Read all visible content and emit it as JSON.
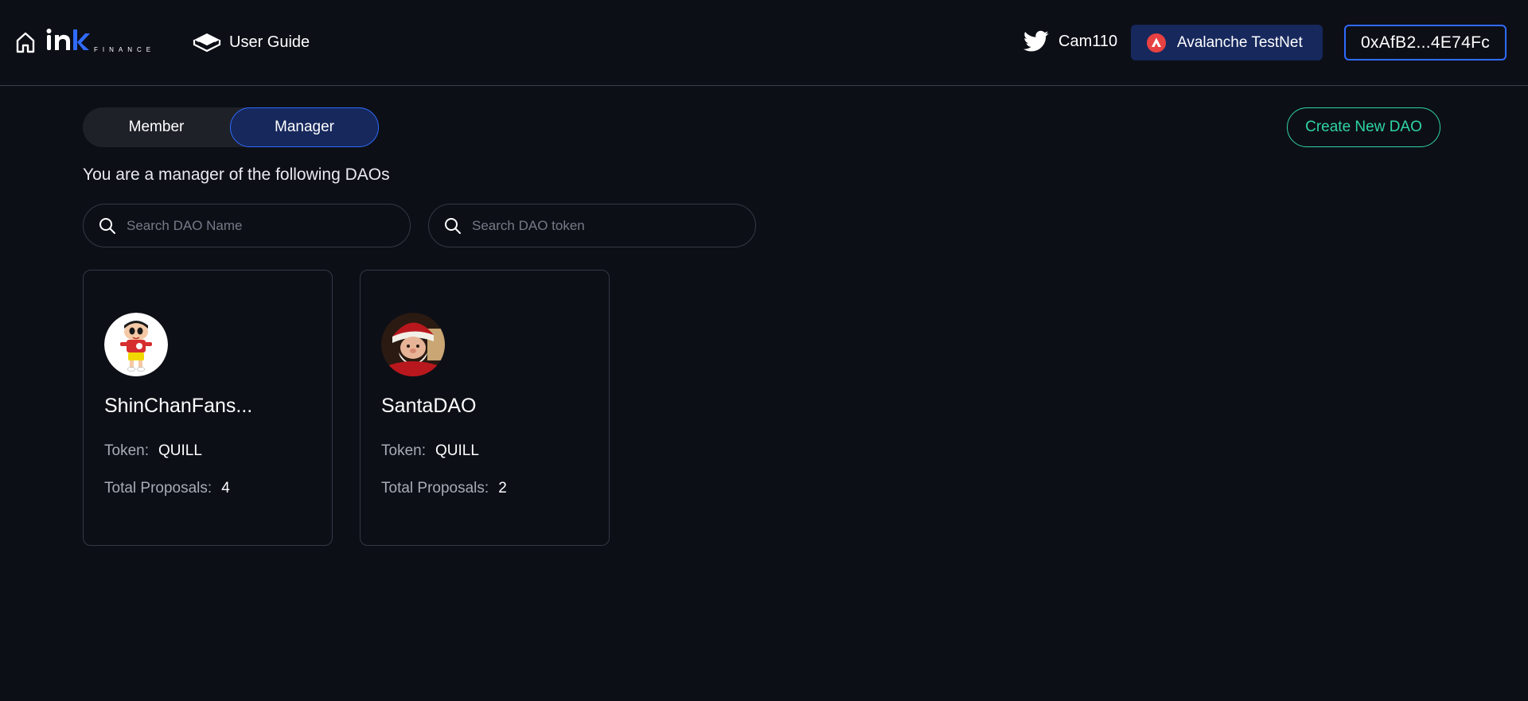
{
  "header": {
    "logo_icon": "ink-finance-logo",
    "home_icon": "home-icon",
    "user_guide_label": "User Guide",
    "twitter_handle": "Cam110",
    "network_label": "Avalanche TestNet",
    "wallet_address": "0xAfB2...4E74Fc"
  },
  "tabs": {
    "member_label": "Member",
    "manager_label": "Manager",
    "active": "Manager"
  },
  "create_button_label": "Create New DAO",
  "subtitle": "You are a manager of the following DAOs",
  "search": {
    "name_placeholder": "Search DAO Name",
    "token_placeholder": "Search DAO token"
  },
  "cards": [
    {
      "name": "ShinChanFans...",
      "token_label": "Token:",
      "token": "QUILL",
      "proposals_label": "Total Proposals:",
      "proposals": "4",
      "avatar": "shinchan-avatar"
    },
    {
      "name": "SantaDAO",
      "token_label": "Token:",
      "token": "QUILL",
      "proposals_label": "Total Proposals:",
      "proposals": "2",
      "avatar": "santa-avatar"
    }
  ],
  "colors": {
    "background": "#0d0f17",
    "accent_blue": "#2f6bff",
    "accent_green": "#2fd5a3",
    "network_bg": "#16285c",
    "avax_red": "#e84142"
  }
}
